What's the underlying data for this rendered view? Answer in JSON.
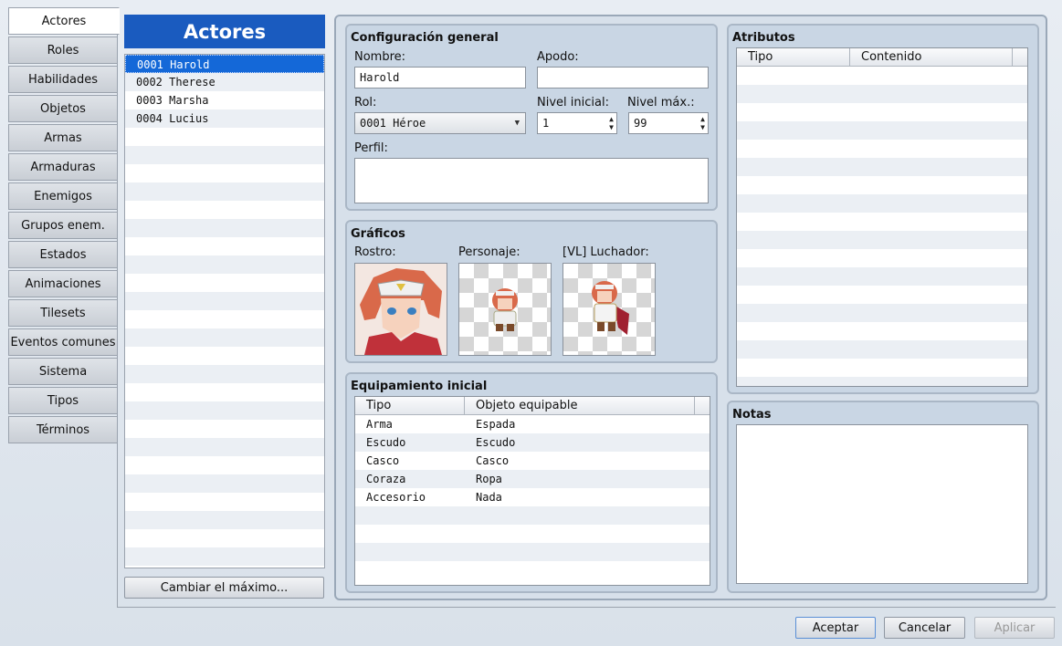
{
  "tabs": [
    "Actores",
    "Roles",
    "Habilidades",
    "Objetos",
    "Armas",
    "Armaduras",
    "Enemigos",
    "Grupos enem.",
    "Estados",
    "Animaciones",
    "Tilesets",
    "Eventos comunes",
    "Sistema",
    "Tipos",
    "Términos"
  ],
  "list": {
    "title": "Actores",
    "items": [
      "0001 Harold",
      "0002 Therese",
      "0003 Marsha",
      "0004 Lucius"
    ],
    "change_max_label": "Cambiar el máximo..."
  },
  "general": {
    "title": "Configuración general",
    "name_label": "Nombre:",
    "name_value": "Harold",
    "nickname_label": "Apodo:",
    "nickname_value": "",
    "class_label": "Rol:",
    "class_value": "0001 Héroe",
    "initial_level_label": "Nivel inicial:",
    "initial_level_value": "1",
    "max_level_label": "Nivel máx.:",
    "max_level_value": "99",
    "profile_label": "Perfil:",
    "profile_value": ""
  },
  "graphics": {
    "title": "Gráficos",
    "face_label": "Rostro:",
    "character_label": "Personaje:",
    "battler_label": "[VL] Luchador:"
  },
  "equipment": {
    "title": "Equipamiento inicial",
    "headers": [
      "Tipo",
      "Objeto equipable"
    ],
    "rows": [
      [
        "Arma",
        "Espada"
      ],
      [
        "Escudo",
        "Escudo"
      ],
      [
        "Casco",
        "Casco"
      ],
      [
        "Coraza",
        "Ropa"
      ],
      [
        "Accesorio",
        "Nada"
      ]
    ]
  },
  "traits": {
    "title": "Atributos",
    "headers": [
      "Tipo",
      "Contenido"
    ]
  },
  "notes": {
    "title": "Notas",
    "value": ""
  },
  "buttons": {
    "ok": "Aceptar",
    "cancel": "Cancelar",
    "apply": "Aplicar"
  },
  "colors": {
    "accent": "#1a5bbf",
    "selection": "#1468d8",
    "panel": "#c9d6e4"
  }
}
